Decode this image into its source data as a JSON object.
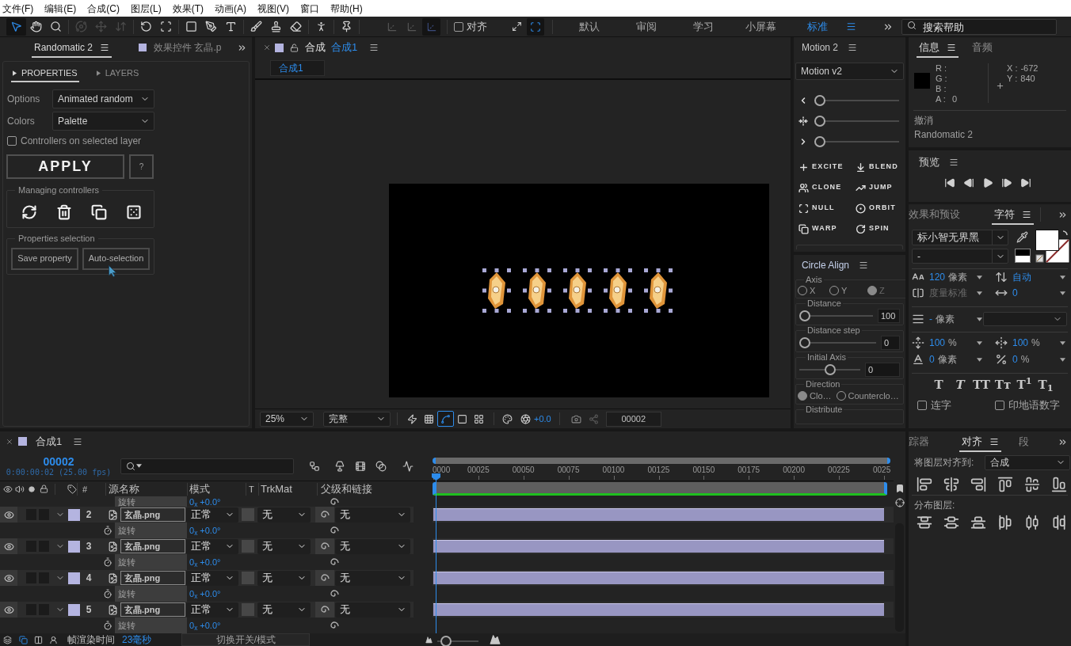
{
  "menu": [
    "文件(F)",
    "编辑(E)",
    "合成(C)",
    "图层(L)",
    "效果(T)",
    "动画(A)",
    "视图(V)",
    "窗口",
    "帮助(H)"
  ],
  "toolbar": {
    "tools": [
      {
        "selected": true,
        "disabled": false
      },
      {
        "selected": false,
        "disabled": false
      },
      {
        "selected": false,
        "disabled": false
      },
      {
        "selected": false,
        "disabled": true
      },
      {
        "selected": false,
        "disabled": true
      },
      {
        "selected": false,
        "disabled": true
      },
      {
        "selected": false,
        "disabled": false
      },
      {
        "selected": false,
        "disabled": false
      },
      {
        "selected": false,
        "disabled": false
      },
      {
        "selected": false,
        "disabled": false
      },
      {
        "selected": false,
        "disabled": false
      },
      {
        "selected": false,
        "disabled": false
      },
      {
        "selected": false,
        "disabled": false
      },
      {
        "selected": false,
        "disabled": false
      },
      {
        "selected": false,
        "disabled": false
      },
      {
        "selected": false,
        "disabled": false
      }
    ],
    "axis_modes": [
      {
        "selected": false
      },
      {
        "selected": false
      },
      {
        "selected": true
      }
    ],
    "snapping": {
      "label": "对齐",
      "checked": false
    },
    "snap_options": [
      {
        "selected": false
      },
      {
        "selected": true
      }
    ],
    "workspaces": [
      {
        "label": "默认",
        "selected": false
      },
      {
        "label": "审阅",
        "selected": false
      },
      {
        "label": "学习",
        "selected": false
      },
      {
        "label": "小屏幕",
        "selected": false
      },
      {
        "label": "标准",
        "selected": true
      }
    ],
    "search": {
      "placeholder": "搜索帮助"
    }
  },
  "left_panel": {
    "tabs": [
      {
        "label": "Randomatic 2",
        "selected": true
      },
      {
        "label": "效果控件 玄晶.p",
        "selected": false
      }
    ],
    "sections": [
      {
        "label": "PROPERTIES",
        "selected": true
      },
      {
        "label": "LAYERS",
        "selected": false
      }
    ],
    "dropdowns": [
      {
        "label": "Options",
        "value": "Animated random"
      },
      {
        "label": "Colors",
        "value": "Palette"
      }
    ],
    "checkbox": {
      "label": "Controllers on selected layer",
      "checked": false
    },
    "apply": "APPLY",
    "help": "?",
    "managing": {
      "title": "Managing controllers"
    },
    "selection": {
      "title": "Properties selection",
      "buttons": [
        "Save property",
        "Auto-selection"
      ]
    }
  },
  "viewer": {
    "tab": {
      "prefix": "合成",
      "name": "合成1"
    },
    "breadcrumb": "合成1",
    "canvas": {
      "items": [
        {
          "selected": true
        },
        {
          "selected": true
        },
        {
          "selected": true
        },
        {
          "selected": true
        },
        {
          "selected": true
        }
      ]
    },
    "zoom": "25%",
    "resolution": "完整",
    "toggles": [
      {
        "selected": false
      },
      {
        "selected": false
      },
      {
        "selected": true
      },
      {
        "selected": false
      },
      {
        "selected": false
      }
    ],
    "exposure": "+0.0",
    "frame": "00002"
  },
  "motion": {
    "title": "Motion 2",
    "preset": "Motion v2",
    "sliders": [
      {
        "level": 0
      },
      {
        "level": 0
      },
      {
        "level": 0
      }
    ],
    "actions": [
      "EXCITE",
      "BLEND",
      "CLONE",
      "JUMP",
      "NULL",
      "ORBIT",
      "WARP",
      "SPIN"
    ]
  },
  "circle_align": {
    "title": "Circle Align",
    "axis": {
      "label": "Axis",
      "options": [
        {
          "label": "X",
          "selected": false
        },
        {
          "label": "Y",
          "selected": false
        },
        {
          "label": "Z",
          "selected": true
        }
      ]
    },
    "sliders": [
      {
        "label": "Distance",
        "level": 0,
        "value": "100"
      },
      {
        "label": "Distance step",
        "level": 0,
        "value": "0"
      },
      {
        "label": "Initial Axis",
        "level": 0.5,
        "value": "0"
      }
    ],
    "direction": {
      "label": "Direction",
      "options": [
        {
          "label": "Clo…",
          "selected": true
        },
        {
          "label": "Counterclo…",
          "selected": false
        }
      ]
    },
    "distribute": {
      "label": "Distribute"
    }
  },
  "info": {
    "tabs": [
      {
        "label": "信息",
        "selected": true
      },
      {
        "label": "音频",
        "selected": false
      }
    ],
    "channels": [
      {
        "label": "R :"
      },
      {
        "label": "G :"
      },
      {
        "label": "B :"
      },
      {
        "label": "A :",
        "value": "0"
      }
    ],
    "position": [
      {
        "label": "X :",
        "value": "-672"
      },
      {
        "label": "Y :",
        "value": "840"
      }
    ],
    "undo": {
      "label": "撤消",
      "action": "Randomatic 2"
    }
  },
  "preview": {
    "title": "预览"
  },
  "character": {
    "tabs": [
      {
        "label": "效果和预设",
        "selected": false
      },
      {
        "label": "字符",
        "selected": true
      }
    ],
    "font": "标小智无界黑",
    "style": "-",
    "metrics": [
      {
        "value": "120",
        "unit": "像素",
        "disabled": false
      },
      {
        "value": "自动",
        "disabled": false
      },
      {
        "value": "度量标准",
        "disabled": true
      },
      {
        "value": "0",
        "disabled": false
      },
      {
        "value": "-",
        "unit": "像素",
        "disabled": false
      },
      {
        "value": "100",
        "unit": "%",
        "disabled": false
      },
      {
        "value": "100",
        "unit": "%",
        "disabled": false
      },
      {
        "value": "0",
        "unit": "像素",
        "disabled": false
      },
      {
        "value": "0",
        "unit": "%",
        "disabled": false
      }
    ],
    "styles": [
      {
        "kind": "bold",
        "label": "T"
      },
      {
        "kind": "italic",
        "label": "T"
      },
      {
        "kind": "caps",
        "label": "TT"
      },
      {
        "kind": "smallcaps",
        "label": "Tᴛ"
      },
      {
        "kind": "super",
        "label": "T$^{1}$"
      },
      {
        "kind": "sub",
        "label": "T$_{1}$"
      }
    ],
    "options": [
      {
        "label": "连字",
        "checked": false
      },
      {
        "label": "印地语数字",
        "checked": false
      }
    ]
  },
  "timeline": {
    "tab": "合成1",
    "timecode": "00002",
    "timecode_detail": "0:00:00:02 (25.00 fps)",
    "columns": [
      "#",
      "源名称",
      "模式",
      "T",
      "TrkMat",
      "父级和链接"
    ],
    "ruler": [
      "0000",
      "00025",
      "00050",
      "00075",
      "00100",
      "00125",
      "00150",
      "00175",
      "00200",
      "00225",
      "0025"
    ],
    "playhead": {
      "level": 0.007
    },
    "scrolled_property": {
      "name": "旋转",
      "value": "0$_{x}$ +0.0°"
    },
    "layers": [
      {
        "number": "2",
        "source": "玄晶.png",
        "mode": "正常",
        "trkmat": "无",
        "parent": "无",
        "visible": true,
        "expanded": true,
        "children": [
          {
            "name": "旋转",
            "value": "0$_{x}$ +0.0°"
          }
        ]
      },
      {
        "number": "3",
        "source": "玄晶.png",
        "mode": "正常",
        "trkmat": "无",
        "parent": "无",
        "visible": true,
        "expanded": true,
        "children": [
          {
            "name": "旋转",
            "value": "0$_{x}$ +0.0°"
          }
        ]
      },
      {
        "number": "4",
        "source": "玄晶.png",
        "mode": "正常",
        "trkmat": "无",
        "parent": "无",
        "visible": true,
        "expanded": true,
        "children": [
          {
            "name": "旋转",
            "value": "0$_{x}$ +0.0°"
          }
        ]
      },
      {
        "number": "5",
        "source": "玄晶.png",
        "mode": "正常",
        "trkmat": "无",
        "parent": "无",
        "visible": true,
        "expanded": true,
        "children": [
          {
            "name": "旋转",
            "value": "0$_{x}$ +0.0°"
          }
        ]
      }
    ]
  },
  "status_bar": {
    "label": "帧渲染时间",
    "render_time": "23毫秒",
    "toggle": "切换开关/模式",
    "zoom": {
      "level": 0.1
    }
  },
  "align": {
    "tabs": [
      {
        "label": "踪器",
        "selected": false
      },
      {
        "label": "对齐",
        "selected": true
      },
      {
        "label": "段",
        "selected": false
      }
    ],
    "align_to": {
      "label": "将图层对齐到:",
      "value": "合成"
    },
    "distribute_label": "分布图层:"
  }
}
